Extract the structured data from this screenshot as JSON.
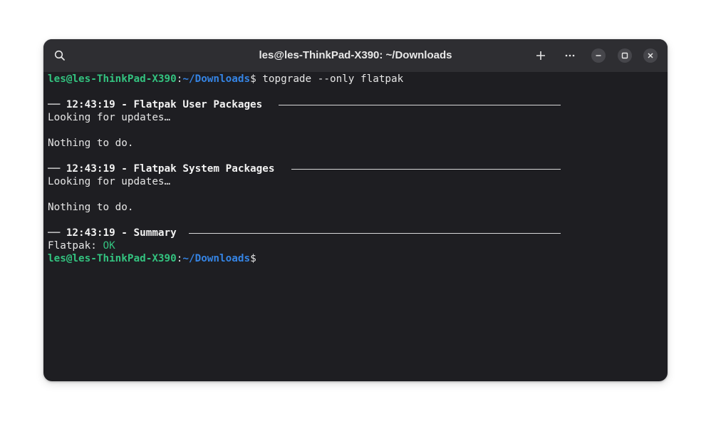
{
  "window": {
    "title": "les@les-ThinkPad-X390: ~/Downloads"
  },
  "titlebar": {
    "search_icon": "search-icon",
    "new_tab_icon": "plus-icon",
    "menu_icon": "ellipsis-icon",
    "minimize_icon": "minimize-icon",
    "maximize_icon": "maximize-icon",
    "close_icon": "close-icon"
  },
  "terminal": {
    "prompt": {
      "user_host": "les@les-ThinkPad-X390",
      "colon": ":",
      "path": "~/Downloads",
      "dollar": "$"
    },
    "command": " topgrade --only flatpak",
    "sections": [
      {
        "header": "── 12:43:19 - Flatpak User Packages",
        "lines": [
          "Looking for updates…",
          "",
          "Nothing to do."
        ]
      },
      {
        "header": "── 12:43:19 - Flatpak System Packages",
        "lines": [
          "Looking for updates…",
          "",
          "Nothing to do."
        ]
      },
      {
        "header": "── 12:43:19 - Summary",
        "summary_label": "Flatpak: ",
        "summary_status": "OK"
      }
    ]
  },
  "colors": {
    "prompt_user": "#33c27f",
    "prompt_path": "#3584e4",
    "status_ok": "#33c27f",
    "background": "#1e1e22",
    "titlebar": "#2e2e32"
  }
}
